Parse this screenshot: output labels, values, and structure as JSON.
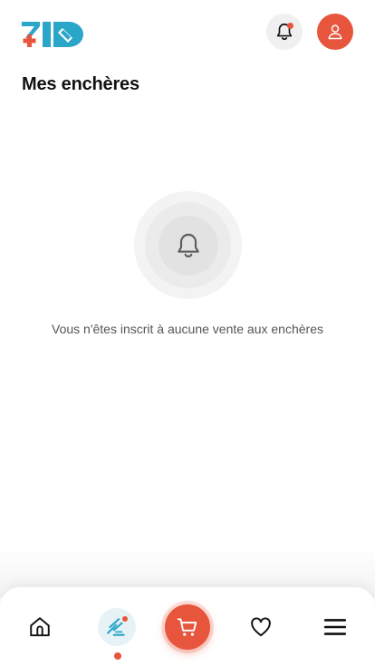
{
  "header": {
    "brand": "ZID",
    "notification_icon": "bell-icon",
    "account_icon": "user-icon"
  },
  "page": {
    "title": "Mes enchères"
  },
  "empty_state": {
    "icon": "bell-icon",
    "message": "Vous n'êtes inscrit à aucune vente aux enchères"
  },
  "bottom_nav": {
    "items": [
      {
        "id": "home",
        "icon": "home-icon"
      },
      {
        "id": "auctions",
        "icon": "gavel-icon",
        "active": true
      },
      {
        "id": "cart",
        "icon": "cart-icon"
      },
      {
        "id": "favorites",
        "icon": "heart-icon"
      },
      {
        "id": "menu",
        "icon": "menu-icon"
      }
    ]
  },
  "colors": {
    "accent": "#e8553d",
    "brand_blue": "#2aa6c9"
  }
}
